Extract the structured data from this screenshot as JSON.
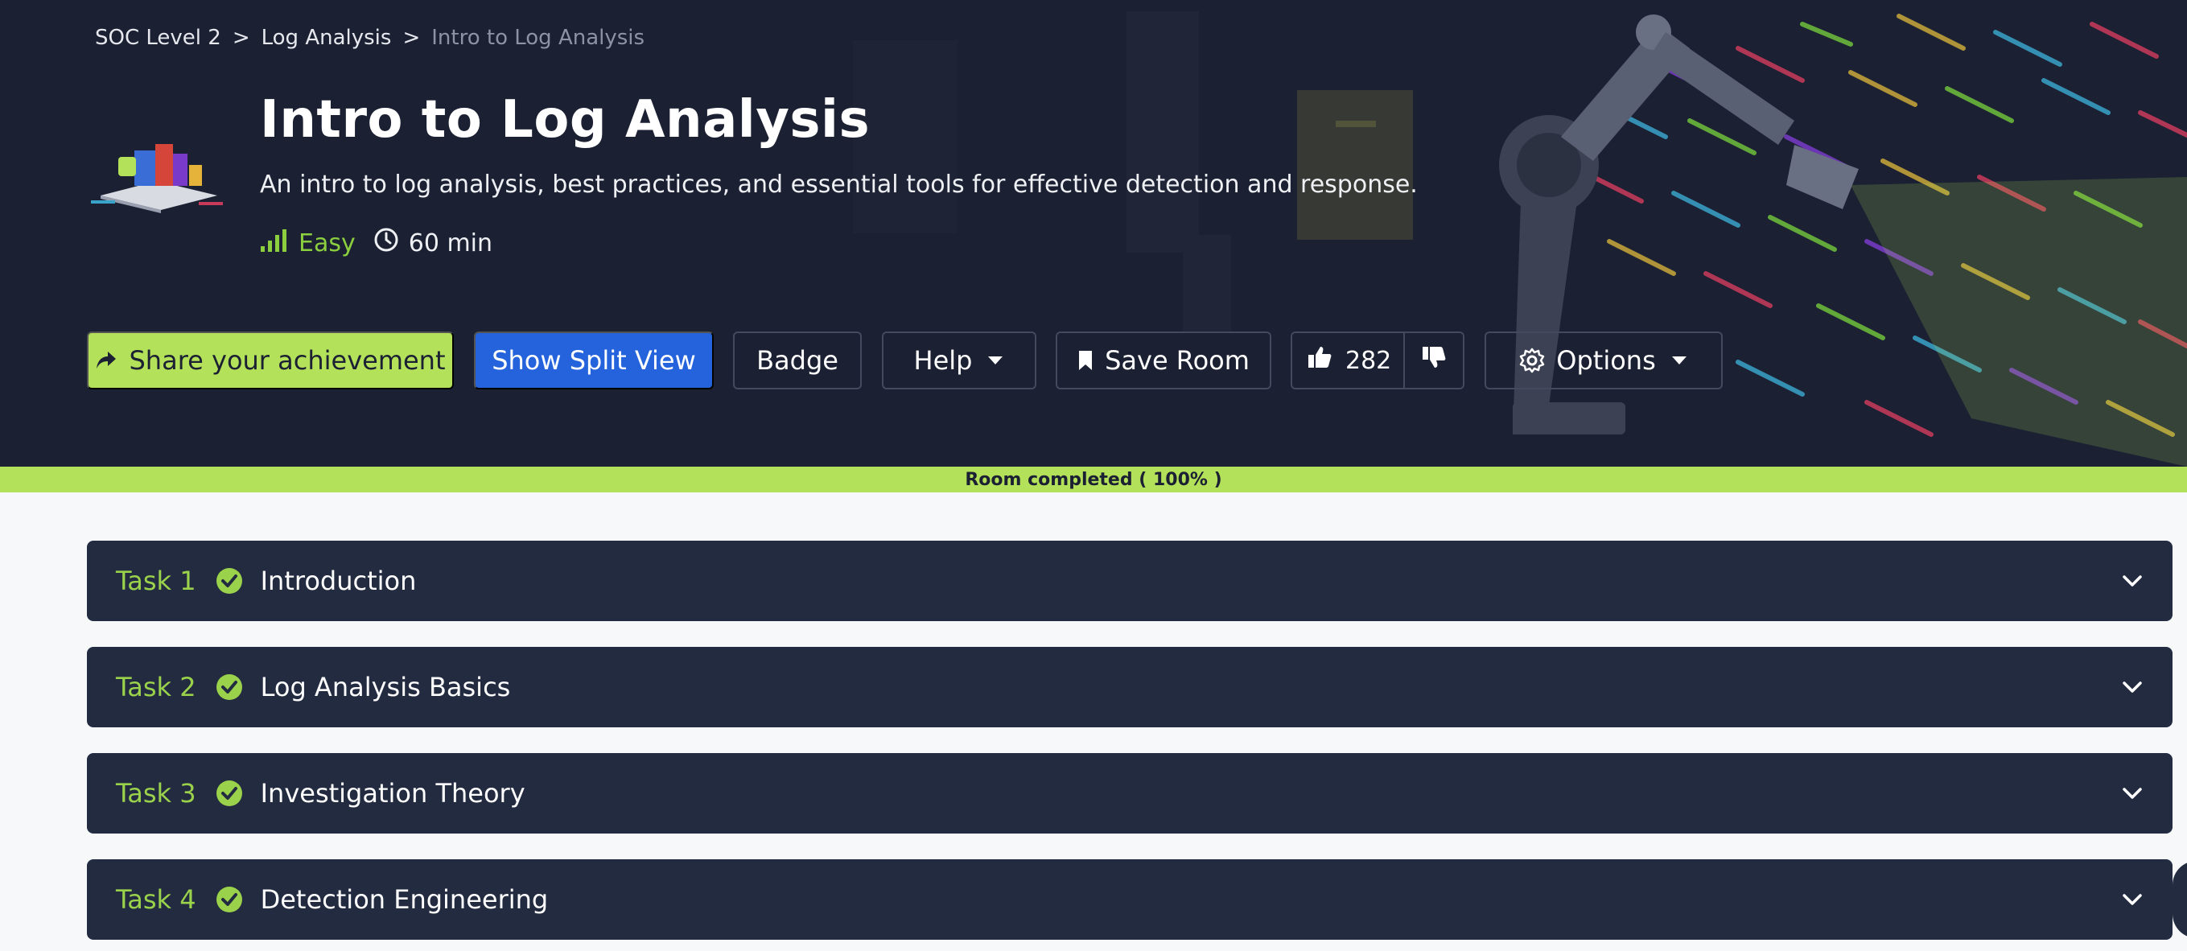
{
  "breadcrumb": {
    "items": [
      "SOC Level 2",
      "Log Analysis",
      "Intro to Log Analysis"
    ],
    "separator": ">"
  },
  "room": {
    "title": "Intro to Log Analysis",
    "description": "An intro to log analysis, best practices, and essential tools for effective detection and response.",
    "difficulty": "Easy",
    "duration": "60 min"
  },
  "actions": {
    "share_label": "Share your achievement",
    "split_view_label": "Show Split View",
    "badge_label": "Badge",
    "help_label": "Help",
    "save_label": "Save Room",
    "likes": "282",
    "options_label": "Options"
  },
  "progress": {
    "label": "Room completed ( 100% )",
    "percent": 100
  },
  "tasks": [
    {
      "number": "Task 1",
      "title": "Introduction",
      "completed": true
    },
    {
      "number": "Task 2",
      "title": "Log Analysis Basics",
      "completed": true
    },
    {
      "number": "Task 3",
      "title": "Investigation Theory",
      "completed": true
    },
    {
      "number": "Task 4",
      "title": "Detection Engineering",
      "completed": true
    }
  ],
  "colors": {
    "header_bg": "#1b2032",
    "accent_green": "#b4e15a",
    "primary_blue": "#2563dc",
    "task_bg": "#232b40",
    "difficulty_green": "#8bcf3f"
  },
  "icons": {
    "share": "share-arrow-icon",
    "help_caret": "caret-down-icon",
    "save": "bookmark-icon",
    "like": "thumbs-up-icon",
    "dislike": "thumbs-down-icon",
    "options": "gear-icon",
    "task_check": "check-circle-icon",
    "task_expand": "chevron-down-icon",
    "difficulty": "signal-bars-icon",
    "duration": "clock-icon"
  }
}
